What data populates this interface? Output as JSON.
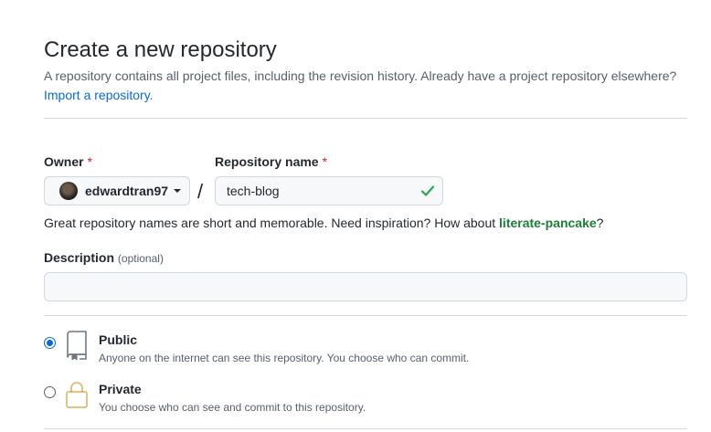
{
  "header": {
    "title": "Create a new repository",
    "subtitle_text": "A repository contains all project files, including the revision history. Already have a project repository elsewhere?",
    "import_link": "Import a repository",
    "import_suffix": "."
  },
  "owner": {
    "label": "Owner",
    "required_mark": "*",
    "selected": "edwardtran97",
    "avatar_icon": "user-avatar"
  },
  "repo": {
    "label": "Repository name",
    "required_mark": "*",
    "value": "tech-blog",
    "valid": true,
    "valid_icon": "check-icon",
    "separator": "/"
  },
  "hint": {
    "text": "Great repository names are short and memorable. Need inspiration? How about ",
    "suggestion": "literate-pancake",
    "suffix": "?"
  },
  "description": {
    "label": "Description",
    "optional": "(optional)",
    "value": "",
    "placeholder": ""
  },
  "visibility": {
    "options": [
      {
        "title": "Public",
        "description": "Anyone on the internet can see this repository. You choose who can commit.",
        "selected": true,
        "icon": "repo-icon"
      },
      {
        "title": "Private",
        "description": "You choose who can see and commit to this repository.",
        "selected": false,
        "icon": "lock-icon"
      }
    ]
  },
  "colors": {
    "link": "#0969da",
    "success": "#1a7f37",
    "required": "#cf222e",
    "border": "#d0d7de"
  }
}
